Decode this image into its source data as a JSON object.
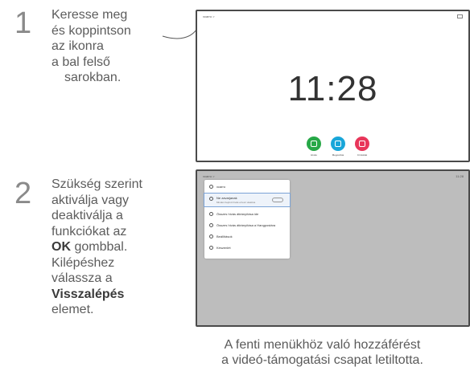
{
  "steps": [
    {
      "number": "1",
      "lines": [
        "Keresse meg",
        "és koppintson",
        "az ikonra",
        "a bal felső",
        "sarokban."
      ]
    },
    {
      "number": "2",
      "lines": [
        "Szükség szerint",
        "aktiválja vagy",
        "deaktiválja a",
        "funkciókat az"
      ],
      "ok": "OK",
      "ok_suffix": " gombbal.",
      "lines2": [
        "Kilépéshez",
        "válassza a"
      ],
      "back": "Visszalépés",
      "back_suffix": "elemet."
    }
  ],
  "screen1": {
    "top_left": "xcarro >",
    "time": "11:28",
    "buttons": [
      {
        "label": "Hívás",
        "color": "#27a847"
      },
      {
        "label": "Megosztás",
        "color": "#19a6d9"
      },
      {
        "label": "Címtárak",
        "color": "#e8365a"
      }
    ]
  },
  "screen2": {
    "top_left": "xcarro >",
    "top_right": "11:28",
    "menu": [
      {
        "label": "xcarro"
      },
      {
        "label": "Ne zavarjanak",
        "sub": "Minden bejövő hívás el lesz utasítva"
      },
      {
        "label": "Összes hívás átirányítása ide"
      },
      {
        "label": "Összes hívás átirányítása a Hangpostára"
      },
      {
        "label": "Beállítások"
      },
      {
        "label": "Készenlét"
      }
    ]
  },
  "footer": [
    "A fenti menükhöz való hozzáférést",
    "a videó-támogatási csapat letiltotta."
  ]
}
